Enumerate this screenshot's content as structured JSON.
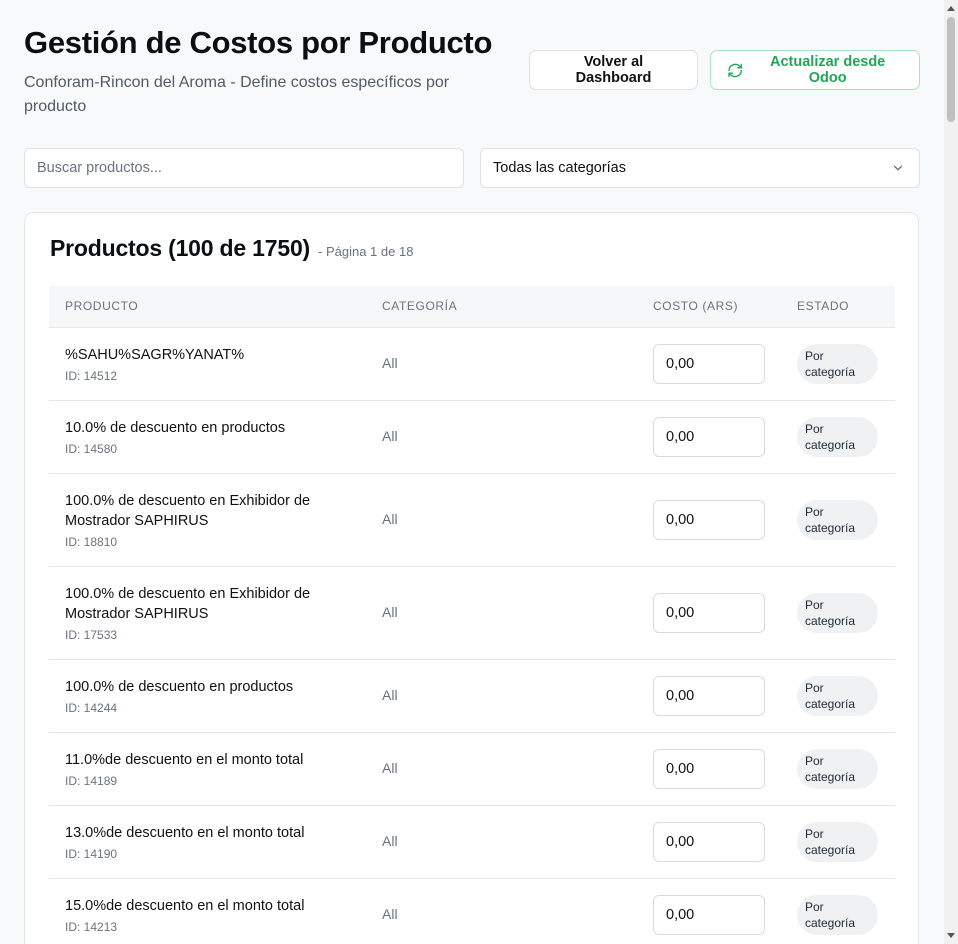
{
  "header": {
    "title": "Gestión de Costos por Producto",
    "subtitle": "Conforam-Rincon del Aroma - Define costos específicos por producto",
    "back_button": "Volver al Dashboard",
    "refresh_button": "Actualizar desde Odoo"
  },
  "filters": {
    "search_placeholder": "Buscar productos...",
    "category_selected": "Todas las categorías"
  },
  "products": {
    "title": "Productos (100 de 1750)",
    "page_info": "- Página 1 de 18",
    "columns": [
      "PRODUCTO",
      "CATEGORÍA",
      "COSTO (ARS)",
      "ESTADO"
    ],
    "rows": [
      {
        "name": "%SAHU%SAGR%YANAT%",
        "id": "ID: 14512",
        "category": "All",
        "cost": "0,00",
        "status": "Por categoría"
      },
      {
        "name": "10.0% de descuento en productos",
        "id": "ID: 14580",
        "category": "All",
        "cost": "0,00",
        "status": "Por categoría"
      },
      {
        "name": "100.0% de descuento en Exhibidor de Mostrador SAPHIRUS",
        "id": "ID: 18810",
        "category": "All",
        "cost": "0,00",
        "status": "Por categoría"
      },
      {
        "name": "100.0% de descuento en Exhibidor de Mostrador SAPHIRUS",
        "id": "ID: 17533",
        "category": "All",
        "cost": "0,00",
        "status": "Por categoría"
      },
      {
        "name": "100.0% de descuento en productos",
        "id": "ID: 14244",
        "category": "All",
        "cost": "0,00",
        "status": "Por categoría"
      },
      {
        "name": "11.0%de descuento en el monto total",
        "id": "ID: 14189",
        "category": "All",
        "cost": "0,00",
        "status": "Por categoría"
      },
      {
        "name": "13.0%de descuento en el monto total",
        "id": "ID: 14190",
        "category": "All",
        "cost": "0,00",
        "status": "Por categoría"
      },
      {
        "name": "15.0%de descuento en el monto total",
        "id": "ID: 14213",
        "category": "All",
        "cost": "0,00",
        "status": "Por categoría"
      }
    ]
  },
  "colors": {
    "accent_green": "#22a559",
    "background": "#f8f9fa"
  }
}
